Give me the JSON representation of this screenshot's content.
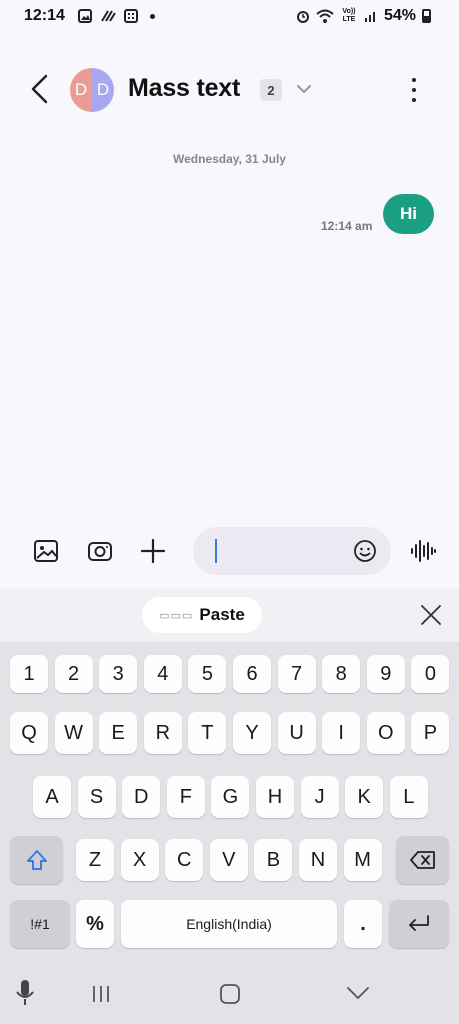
{
  "status_bar": {
    "time": "12:14",
    "network": "Vo)) LTE",
    "battery": "54%"
  },
  "header": {
    "avatar_letters": [
      "D",
      "D"
    ],
    "title": "Mass text",
    "participant_count": "2"
  },
  "conversation": {
    "date_label": "Wednesday, 31 July",
    "messages": [
      {
        "text": "Hi",
        "time": "12:14 am",
        "direction": "outgoing"
      }
    ]
  },
  "compose": {
    "placeholder": "",
    "value": ""
  },
  "suggestion_bar": {
    "paste_label": "Paste"
  },
  "keyboard": {
    "row_numbers": [
      "1",
      "2",
      "3",
      "4",
      "5",
      "6",
      "7",
      "8",
      "9",
      "0"
    ],
    "row_top": [
      "Q",
      "W",
      "E",
      "R",
      "T",
      "Y",
      "U",
      "I",
      "O",
      "P"
    ],
    "row_middle": [
      "A",
      "S",
      "D",
      "F",
      "G",
      "H",
      "J",
      "K",
      "L"
    ],
    "row_bottom": [
      "Z",
      "X",
      "C",
      "V",
      "B",
      "N",
      "M"
    ],
    "symbols_label": "!#1",
    "percent_label": "%",
    "space_label": "English(India)",
    "period_label": "."
  },
  "colors": {
    "accent": "#1a9f83",
    "avatar_left": "#e79d92",
    "avatar_right": "#a8a8ef",
    "cursor": "#3a7be0"
  }
}
